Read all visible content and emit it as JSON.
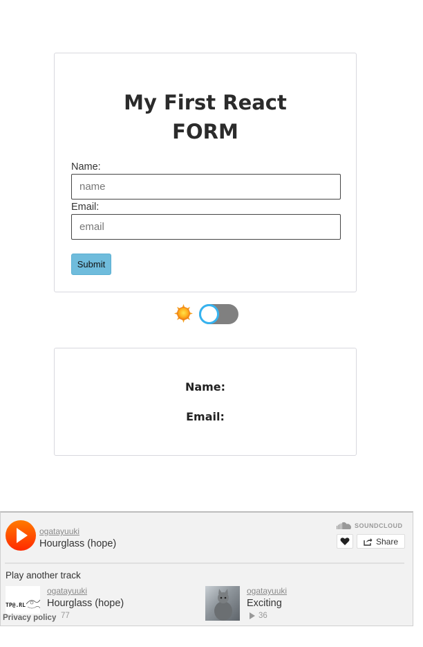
{
  "form": {
    "title_line1": "My First React",
    "title_line2": "FORM",
    "name_label": "Name:",
    "name_placeholder": "name",
    "name_value": "",
    "email_label": "Email:",
    "email_placeholder": "email",
    "email_value": "",
    "submit_label": "Submit"
  },
  "theme_toggle": {
    "icon": "sun-icon",
    "state": "off",
    "knob_color": "#36b3f0",
    "track_color": "#808080"
  },
  "output": {
    "name_label": "Name:",
    "email_label": "Email:"
  },
  "soundcloud": {
    "brand": "SOUNDCLOUD",
    "current": {
      "user": "ogatayuuki",
      "track": "Hourglass (hope)"
    },
    "share_label": "Share",
    "another_label": "Play another track",
    "tracks": [
      {
        "user": "ogatayuuki",
        "title": "Hourglass (hope)",
        "plays": "77"
      },
      {
        "user": "ogatayuuki",
        "title": "Exciting",
        "plays": "36"
      }
    ],
    "privacy_label": "Privacy policy",
    "accent_color": "#ff5500"
  }
}
